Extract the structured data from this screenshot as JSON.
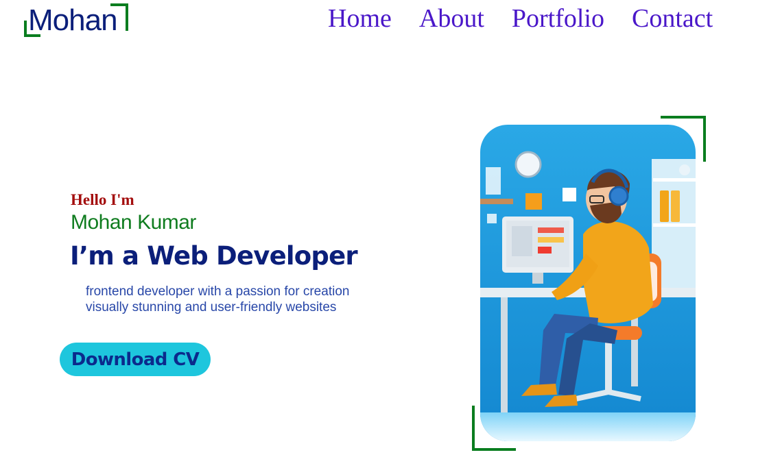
{
  "logo": {
    "text": "Mohan"
  },
  "nav": {
    "items": [
      {
        "label": "Home"
      },
      {
        "label": "About"
      },
      {
        "label": "Portfolio"
      },
      {
        "label": "Contact"
      }
    ]
  },
  "hero": {
    "greeting": "Hello I'm",
    "name": "Mohan Kumar",
    "role": "I’m a Web Developer",
    "description_lines": [
      "frontend developer with a passion for creation",
      "visually stunning and user-friendly websites"
    ],
    "cta_label": "Download CV",
    "image": "developer-illustration"
  },
  "colors": {
    "accent_green": "#0a7d1f",
    "nav_purple": "#4a17c9",
    "brand_navy": "#0b1f7a",
    "greeting_red": "#a30d0d",
    "button_cyan": "#1ec6dd"
  }
}
